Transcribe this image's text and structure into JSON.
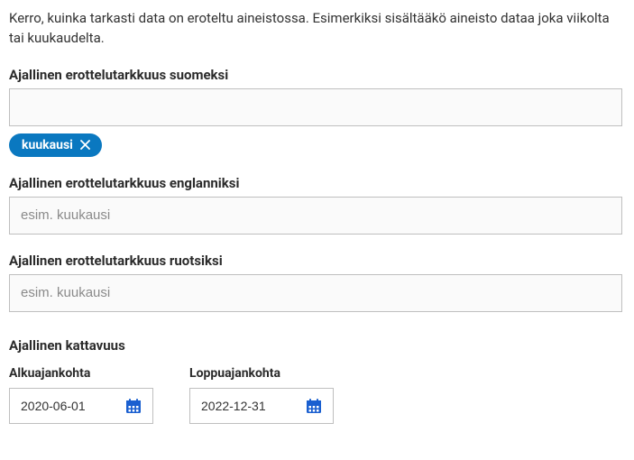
{
  "description": "Kerro, kuinka tarkasti data on eroteltu aineistossa. Esimerkiksi sisältääkö aineisto dataa joka viikolta tai kuukaudelta.",
  "fields": {
    "fi": {
      "label": "Ajallinen erottelutarkkuus suomeksi",
      "value": "",
      "placeholder": "",
      "tags": [
        "kuukausi"
      ]
    },
    "en": {
      "label": "Ajallinen erottelutarkkuus englanniksi",
      "value": "",
      "placeholder": "esim. kuukausi"
    },
    "sv": {
      "label": "Ajallinen erottelutarkkuus ruotsiksi",
      "value": "",
      "placeholder": "esim. kuukausi"
    }
  },
  "temporal": {
    "heading": "Ajallinen kattavuus",
    "start": {
      "label": "Alkuajankohta",
      "value": "2020-06-01"
    },
    "end": {
      "label": "Loppuajankohta",
      "value": "2022-12-31"
    }
  },
  "icons": {
    "close": "close-icon",
    "calendar": "calendar-icon"
  }
}
